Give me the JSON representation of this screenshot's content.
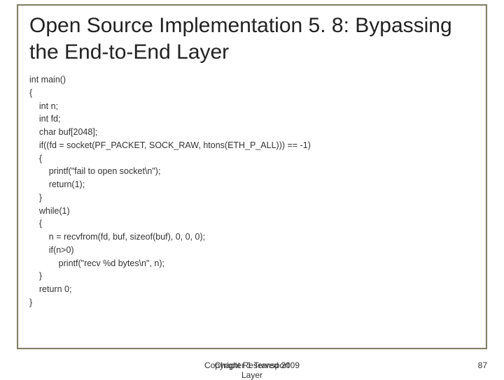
{
  "title": "Open Source Implementation 5. 8: Bypassing the End-to-End Layer",
  "code": "int main()\n{\n    int n;\n    int fd;\n    char buf[2048];\n    if((fd = socket(PF_PACKET, SOCK_RAW, htons(ETH_P_ALL))) == -1)\n    {\n        printf(\"fail to open socket\\n\");\n        return(1);\n    }\n    while(1)\n    {\n        n = recvfrom(fd, buf, sizeof(buf), 0, 0, 0);\n        if(n>0)\n            printf(\"recv %d bytes\\n\", n);\n    }\n    return 0;\n}",
  "footer": {
    "line1": "Copyright Reserved 2009",
    "line2": "Chapter 1 Transport Layer"
  },
  "page_number": "87"
}
